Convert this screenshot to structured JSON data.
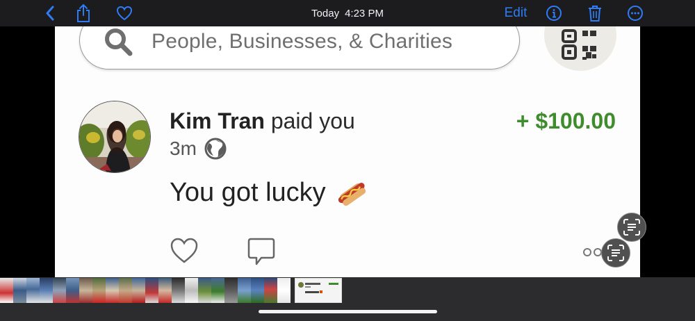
{
  "toolbar": {
    "back_icon": "chevron-left-icon",
    "share_icon": "share-icon",
    "favorite_icon": "heart-icon",
    "date_label": "Today",
    "time_label": "4:23 PM",
    "edit_label": "Edit",
    "info_icon": "info-icon",
    "delete_icon": "trash-icon",
    "more_icon": "ellipsis-icon",
    "accent_color": "#2f7cf6"
  },
  "screenshot": {
    "search": {
      "placeholder": "People, Businesses, & Charities",
      "icon": "search-icon",
      "qr_icon": "qr-code-icon"
    },
    "transaction": {
      "name": "Kim Tran",
      "action": "paid you",
      "time": "3m",
      "privacy_icon": "globe-icon",
      "amount": "+ $100.00",
      "amount_color": "#3f8c2c",
      "note": "You got lucky",
      "note_emoji": "hotdog-icon",
      "like_icon": "heart-outline-icon",
      "comment_icon": "comment-icon",
      "more_icon": "more-dots-icon"
    }
  },
  "live_text": {
    "button_icon": "live-text-icon"
  }
}
